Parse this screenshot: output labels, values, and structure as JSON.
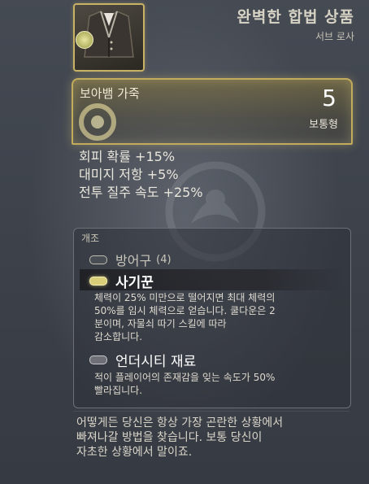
{
  "item": {
    "title": "완벽한 합법 상품",
    "subtitle": "서브 로사",
    "thumbnail_icon": "vest-icon",
    "name": "보아뱀 가죽",
    "gear_score": "5",
    "rarity": "보통형",
    "accent_color": "#c2ac5c"
  },
  "stats": [
    "회피 확률 +15%",
    "대미지 저항 +5%",
    "전투 질주 속도 +25%"
  ],
  "mods": {
    "header": "개조",
    "armor_slot": {
      "label": "방어구",
      "count": "(4)"
    },
    "perk": {
      "name": "사기꾼",
      "desc_lines": [
        "체력이 25% 미만으로 떨어지면 최대 체력의",
        "50%를 임시 체력으로 얻습니다. 쿨다운은 2",
        "분이며, 자물쇠 따기 스킬에 따라",
        "감소합니다."
      ]
    },
    "material": {
      "name": "언더시티 재료",
      "desc_lines": [
        "적이 플레이어의 존재감을 잊는 속도가 50%",
        "빨라집니다."
      ]
    }
  },
  "flavor_lines": [
    "어떻게든 당신은 항상 가장 곤란한 상황에서",
    "빠져나갈 방법을 찾습니다. 보통 당신이",
    "자초한 상황에서 말이죠."
  ]
}
